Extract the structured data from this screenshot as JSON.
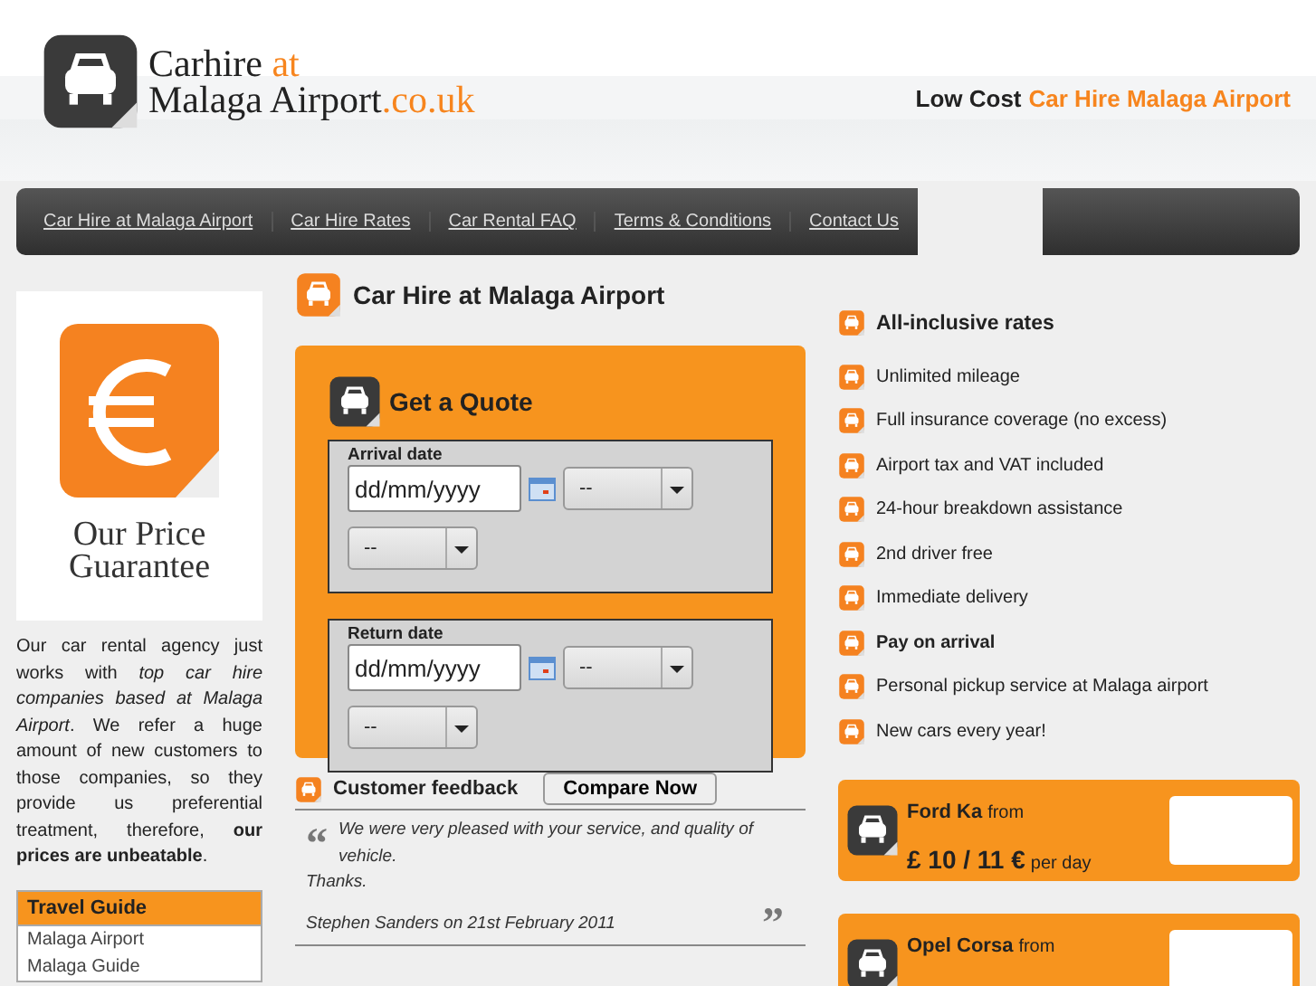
{
  "header": {
    "logo": {
      "line1": "Carhire",
      "line1_accent": "at",
      "line2": "Malaga Airport",
      "line2_accent": ".co.uk"
    },
    "tagline": {
      "plain": "Low Cost",
      "accent": "Car Hire Malaga Airport"
    }
  },
  "nav": {
    "items": [
      {
        "label": "Car Hire at Malaga Airport"
      },
      {
        "label": "Car Hire Rates"
      },
      {
        "label": "Car Rental FAQ"
      },
      {
        "label": "Terms & Conditions"
      },
      {
        "label": "Contact Us"
      }
    ]
  },
  "sidebar": {
    "guarantee": {
      "line1": "Our Price",
      "line2": "Guarantee"
    },
    "text": "Our car rental agency just works with *top car hire companies based at Malaga Airport*. We refer a huge amount of new customers to those companies, so they provide us preferential treatment, therefore, **our prices are unbeatable**.",
    "travel_guide": {
      "title": "Travel Guide",
      "items": [
        "Malaga Airport",
        "Malaga Guide"
      ]
    }
  },
  "main": {
    "title": "Car Hire at Malaga Airport",
    "quote": {
      "title": "Get a Quote",
      "fieldsets": [
        {
          "label": "Arrival date",
          "date_value": "dd/mm/yyyy",
          "selects": [
            "--",
            "--"
          ]
        },
        {
          "label": "Return date",
          "date_value": "dd/mm/yyyy",
          "selects": [
            "--",
            "--"
          ]
        }
      ]
    },
    "feedback": {
      "title": "Customer feedback",
      "compare_button": "Compare Now",
      "open_quote": "“",
      "text": "We were very pleased with your service, and quality of vehicle.",
      "thanks": "Thanks.",
      "author": "Stephen Sanders on 21st February 2011",
      "close_quote": "”"
    }
  },
  "rates": {
    "title": "All-inclusive rates",
    "items": [
      {
        "label": "Unlimited mileage",
        "emphasis": false
      },
      {
        "label": "Full insurance coverage (no excess)",
        "emphasis": false
      },
      {
        "label": "Airport tax and VAT included",
        "emphasis": false
      },
      {
        "label": "24-hour breakdown assistance",
        "emphasis": false
      },
      {
        "label": "2nd driver free",
        "emphasis": false
      },
      {
        "label": "Immediate delivery",
        "emphasis": false
      },
      {
        "label": "Pay on arrival",
        "emphasis": true
      },
      {
        "label": "Personal pickup service at Malaga airport",
        "emphasis": false
      },
      {
        "label": "New cars every year!",
        "emphasis": false
      }
    ]
  },
  "offers": [
    {
      "car": "Ford Ka",
      "from": "from",
      "price": "£ 10 / 11 €",
      "unit": "per day"
    },
    {
      "car": "Opel Corsa",
      "from": "from"
    }
  ]
}
